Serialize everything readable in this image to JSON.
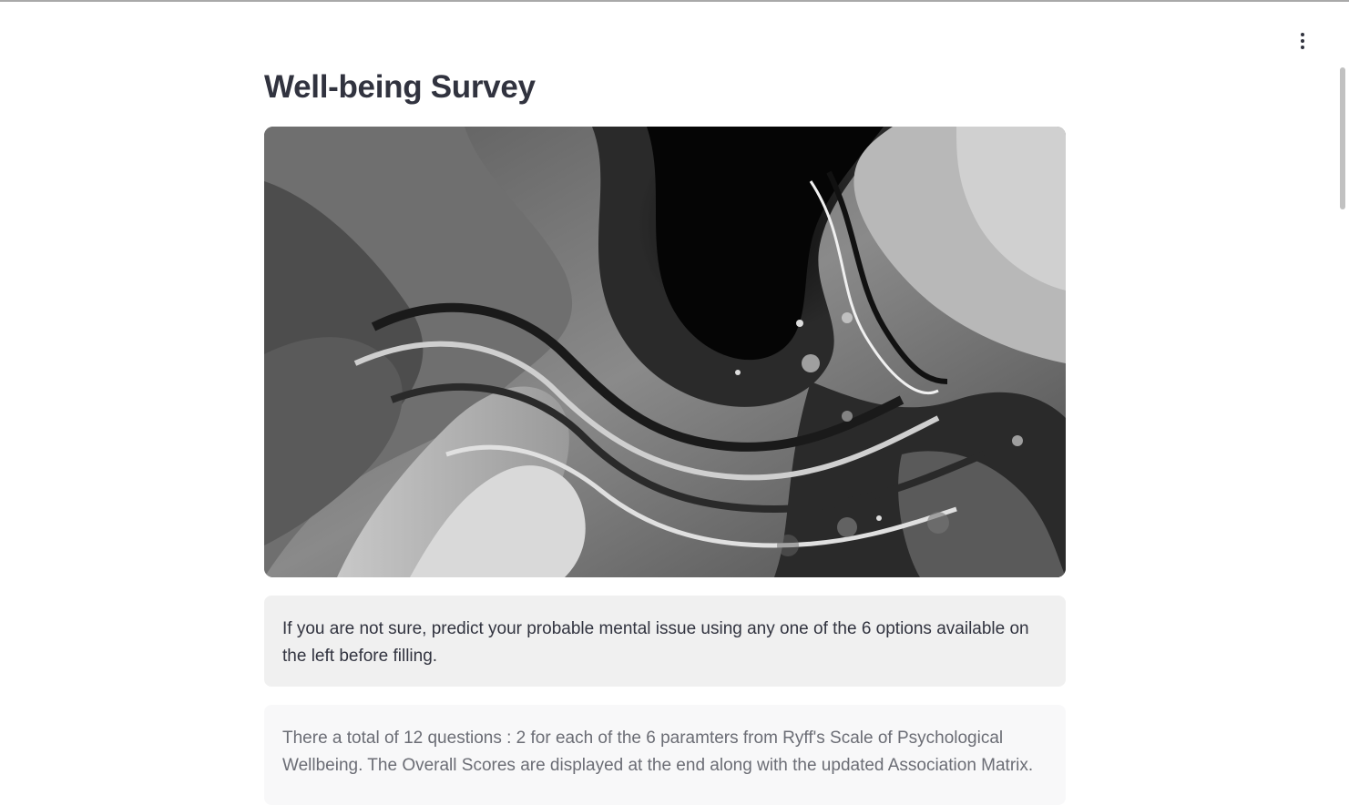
{
  "page": {
    "title": "Well-being Survey"
  },
  "header": {
    "menu_icon": "kebab-menu-icon"
  },
  "hero_image": {
    "description_icon": "abstract-fluid-art-image"
  },
  "info_box": {
    "text": "If you are not sure, predict your probable mental issue using any one of the 6 options available on the left before filling."
  },
  "note_box": {
    "text": "There a total of 12 questions : 2 for each of the 6 paramters from Ryff's Scale of Psychological Wellbeing. The Overall Scores are displayed at the end along with the updated Association Matrix."
  },
  "colors": {
    "text": "#31333f",
    "info_bg": "#f0f0f0",
    "note_bg": "#f8f8f9",
    "note_text": "#6b6d75"
  }
}
